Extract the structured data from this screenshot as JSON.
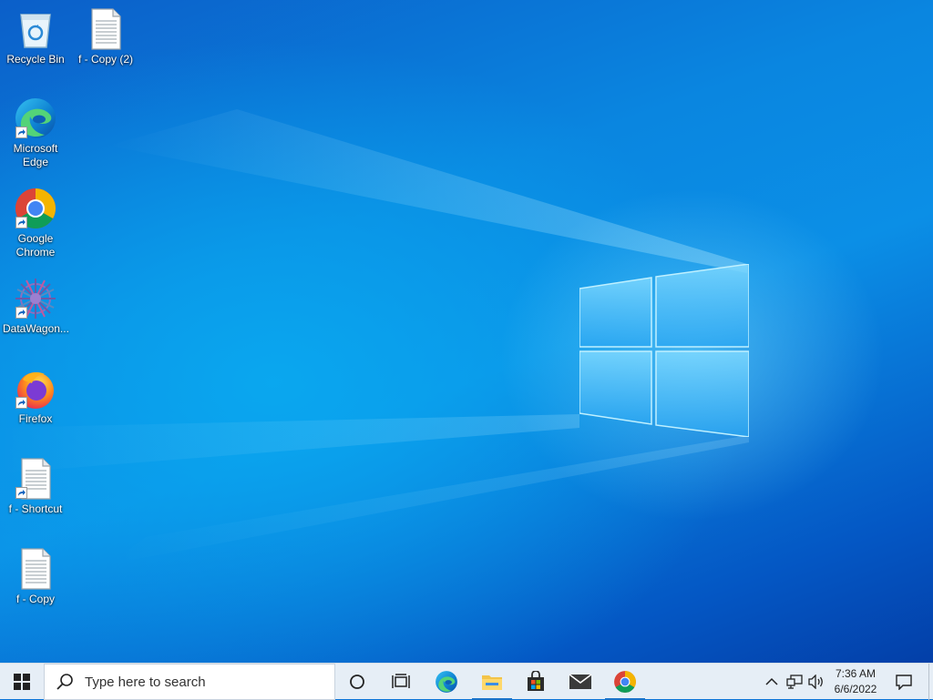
{
  "desktop": {
    "icons": [
      {
        "label": "Recycle Bin",
        "icon": "recycle-bin-icon",
        "shortcut": false
      },
      {
        "label": "f - Copy (2)",
        "icon": "text-document-icon",
        "shortcut": false
      },
      {
        "label": "Microsoft Edge",
        "icon": "edge-icon",
        "shortcut": true
      },
      {
        "label": "Google Chrome",
        "icon": "chrome-icon",
        "shortcut": true
      },
      {
        "label": "DataWagon...",
        "icon": "datawagon-icon",
        "shortcut": true
      },
      {
        "label": "Firefox",
        "icon": "firefox-icon",
        "shortcut": true
      },
      {
        "label": "f - Shortcut",
        "icon": "text-document-icon",
        "shortcut": true
      },
      {
        "label": "f - Copy",
        "icon": "text-document-icon",
        "shortcut": false
      }
    ]
  },
  "taskbar": {
    "search_placeholder": "Type here to search",
    "pinned": [
      {
        "name": "cortana",
        "icon": "circle-icon"
      },
      {
        "name": "task-view",
        "icon": "task-view-icon"
      },
      {
        "name": "edge",
        "icon": "edge-icon",
        "active": false
      },
      {
        "name": "file-explorer",
        "icon": "folder-icon",
        "active": true
      },
      {
        "name": "store",
        "icon": "store-icon",
        "active": false
      },
      {
        "name": "mail",
        "icon": "mail-icon",
        "active": false
      },
      {
        "name": "chrome",
        "icon": "chrome-icon",
        "active": true
      }
    ],
    "tray": {
      "time": "7:36 AM",
      "date": "6/6/2022"
    }
  },
  "colors": {
    "accent": "#1a73c9",
    "taskbar_bg": "#e6eef6",
    "desktop_blue": "#0a74d8"
  }
}
